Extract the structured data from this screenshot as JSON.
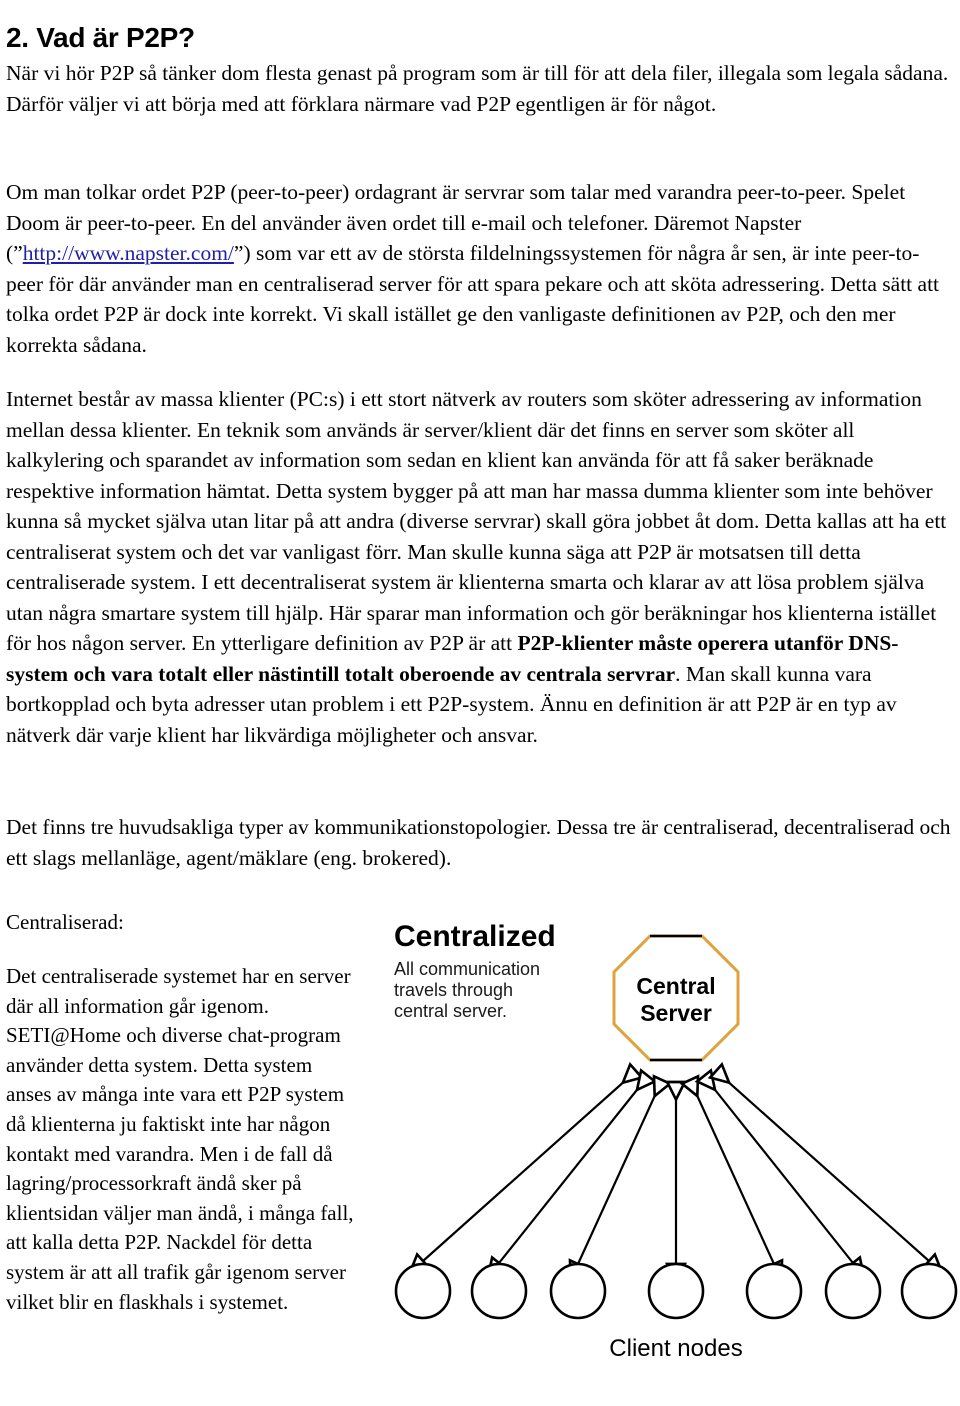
{
  "heading": "2. Vad är P2P?",
  "paragraphs": {
    "p1": "När vi hör P2P så tänker dom flesta genast på program som är till för att dela filer, illegala som legala sådana. Därför väljer vi att börja med att förklara närmare vad P2P egentligen är för något.",
    "p2_before_link": "Om man tolkar ordet P2P (peer-to-peer) ordagrant är servrar som talar med varandra peer-to-peer. Spelet Doom är peer-to-peer. En del använder även ordet till e-mail och telefoner. Däremot Napster (”",
    "p2_link": "http://www.napster.com/",
    "p2_after_link": "”) som var ett av de största fildelningssystemen för några år sen, är inte peer-to-peer för där använder man en centraliserad server för att spara pekare och att sköta adressering. Detta sätt att tolka ordet P2P är dock inte korrekt. Vi skall istället ge den vanligaste definitionen av P2P, och den mer korrekta sådana.",
    "p3_before_bold": "Internet består av massa klienter (PC:s) i ett stort nätverk av routers som sköter adressering av information mellan dessa klienter. En teknik som används är server/klient där det finns en server som sköter all kalkylering och sparandet av information som sedan en klient kan använda för att få saker beräknade respektive information hämtat. Detta system bygger på att man har massa dumma klienter som inte behöver kunna så mycket själva utan litar på att andra (diverse servrar) skall göra jobbet åt dom. Detta kallas att ha ett centraliserat system och det var vanligast förr. Man skulle kunna säga att P2P är motsatsen till detta centraliserade system. I ett decentraliserat system är klienterna smarta och klarar av att lösa problem själva utan några smartare system till hjälp. Här sparar man information och gör beräkningar hos klienterna istället för hos någon server. En ytterligare definition av P2P är att ",
    "p3_bold": "P2P-klienter måste operera utanför DNS-system och vara totalt eller nästintill totalt oberoende av centrala servrar",
    "p3_after_bold": ". Man skall kunna vara bortkopplad och byta adresser utan problem i ett P2P-system. Ännu en definition är att P2P är en typ av nätverk där varje klient har likvärdiga möjligheter och ansvar.",
    "p4": "Det finns tre huvudsakliga typer av kommunikationstopologier. Dessa tre är centraliserad, decentraliserad och ett slags mellanläge, agent/mäklare (eng. brokered)."
  },
  "lower_section": {
    "label": "Centraliserad:",
    "text": "Det centraliserade systemet har en server där all information går igenom. SETI@Home och diverse chat-program använder detta system. Detta system anses av många inte vara ett P2P system då klienterna ju faktiskt inte har någon kontakt med varandra. Men i de fall då lagring/processorkraft ändå sker på klientsidan väljer man ändå, i många fall, att kalla detta P2P. Nackdel för detta system är att all trafik går igenom server vilket blir en flaskhals i systemet."
  },
  "diagram": {
    "title": "Centralized",
    "subtitle_lines": [
      "All communication",
      "travels through",
      "central server."
    ],
    "server_label_line1": "Central",
    "server_label_line2": "Server",
    "clients_caption": "Client nodes",
    "client_count": 7,
    "colors": {
      "server_outline": "#e0a23c",
      "stroke": "#000000",
      "fill": "#ffffff"
    }
  },
  "link_color": "#1f1fa8"
}
